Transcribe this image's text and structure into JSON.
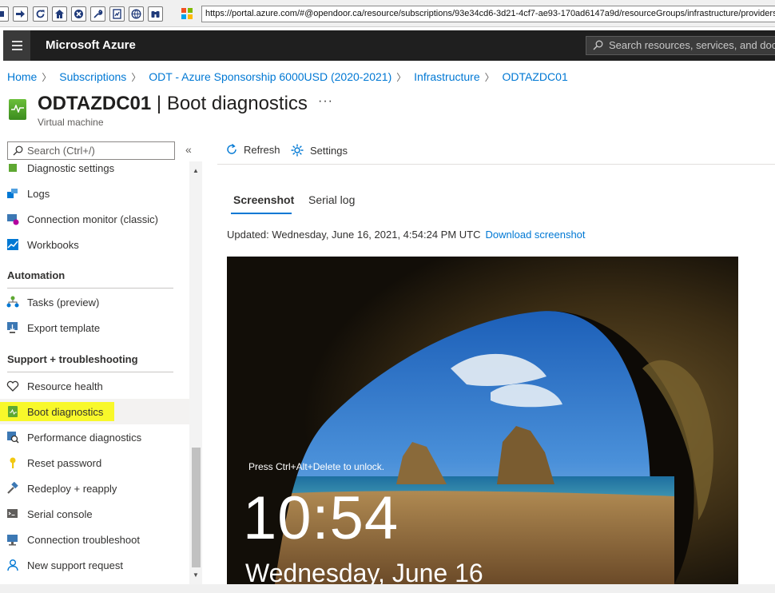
{
  "browser": {
    "url": "https://portal.azure.com/#@opendoor.ca/resource/subscriptions/93e34cd6-3d21-4cf7-ae93-170ad6147a9d/resourceGroups/infrastructure/providers"
  },
  "header": {
    "app_title": "Microsoft Azure",
    "search_placeholder": "Search resources, services, and docs"
  },
  "breadcrumb": [
    "Home",
    "Subscriptions",
    "ODT - Azure Sponsorship 6000USD (2020-2021)",
    "Infrastructure",
    "ODTAZDC01"
  ],
  "title": {
    "resource": "ODTAZDC01",
    "separator": " | ",
    "blade": "Boot diagnostics",
    "more": "···",
    "subtitle": "Virtual machine"
  },
  "sidebar": {
    "search_placeholder": "Search (Ctrl+/)",
    "collapse": "«",
    "items_top": [
      {
        "label": "Diagnostic settings",
        "icon": "diagnostic-settings-icon"
      },
      {
        "label": "Logs",
        "icon": "logs-icon"
      },
      {
        "label": "Connection monitor (classic)",
        "icon": "connection-monitor-icon"
      },
      {
        "label": "Workbooks",
        "icon": "workbooks-icon"
      }
    ],
    "section_automation": "Automation",
    "items_automation": [
      {
        "label": "Tasks (preview)",
        "icon": "tasks-icon"
      },
      {
        "label": "Export template",
        "icon": "export-template-icon"
      }
    ],
    "section_support": "Support + troubleshooting",
    "items_support": [
      {
        "label": "Resource health",
        "icon": "heart-icon"
      },
      {
        "label": "Boot diagnostics",
        "icon": "boot-diagnostics-icon"
      },
      {
        "label": "Performance diagnostics",
        "icon": "performance-icon"
      },
      {
        "label": "Reset password",
        "icon": "key-icon"
      },
      {
        "label": "Redeploy + reapply",
        "icon": "hammer-icon"
      },
      {
        "label": "Serial console",
        "icon": "console-icon"
      },
      {
        "label": "Connection troubleshoot",
        "icon": "troubleshoot-icon"
      },
      {
        "label": "New support request",
        "icon": "support-person-icon"
      }
    ]
  },
  "commands": {
    "refresh": "Refresh",
    "settings": "Settings"
  },
  "tabs": [
    "Screenshot",
    "Serial log"
  ],
  "updated": {
    "text": "Updated: Wednesday, June 16, 2021, 4:54:24 PM UTC",
    "link": "Download screenshot"
  },
  "lock_screen": {
    "message": "Press Ctrl+Alt+Delete to unlock.",
    "time": "10:54",
    "date": "Wednesday, June 16"
  },
  "colors": {
    "accent": "#0078d4",
    "highlight": "#f8f82a",
    "header_bg": "#1f1f1f"
  }
}
